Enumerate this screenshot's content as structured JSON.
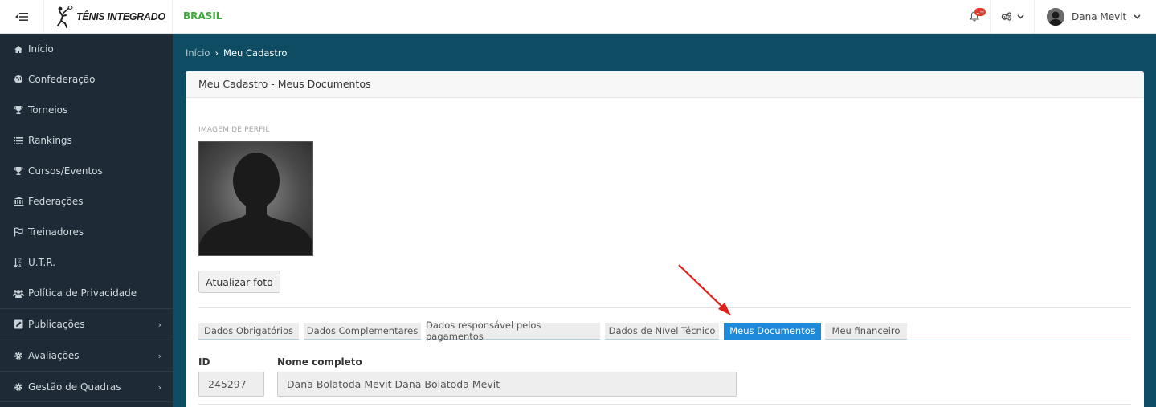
{
  "topbar": {
    "logo_text": "TÊNIS INTEGRADO",
    "country": "BRASIL",
    "notification_badge": "1+",
    "user_name": "Dana Mevit"
  },
  "sidebar": {
    "items": [
      {
        "label": "Início",
        "icon": "home-icon"
      },
      {
        "label": "Confederação",
        "icon": "globe-icon"
      },
      {
        "label": "Torneios",
        "icon": "trophy-icon"
      },
      {
        "label": "Rankings",
        "icon": "list-icon"
      },
      {
        "label": "Cursos/Eventos",
        "icon": "trophy-icon"
      },
      {
        "label": "Federações",
        "icon": "institution-icon"
      },
      {
        "label": "Treinadores",
        "icon": "flag-icon"
      },
      {
        "label": "U.T.R.",
        "icon": "sort-alpha-icon"
      },
      {
        "label": "Política de Privacidade",
        "icon": "users-icon"
      },
      {
        "label": "Publicações",
        "icon": "edit-icon",
        "arrow": "›"
      },
      {
        "label": "Avaliações",
        "icon": "gear-icon",
        "arrow": "›"
      },
      {
        "label": "Gestão de Quadras",
        "icon": "gear-icon",
        "arrow": "›"
      }
    ]
  },
  "breadcrumb": {
    "home": "Início",
    "separator": "›",
    "current": "Meu Cadastro"
  },
  "card": {
    "title": "Meu Cadastro - Meus Documentos",
    "profile_label": "IMAGEM DE PERFIL",
    "update_button": "Atualizar foto",
    "tabs": [
      {
        "label": "Dados Obrigatórios",
        "active": false
      },
      {
        "label": "Dados Complementares",
        "active": false
      },
      {
        "label": "Dados responsável pelos pagamentos",
        "active": false
      },
      {
        "label": "Dados de Nível Técnico",
        "active": false
      },
      {
        "label": "Meus Documentos",
        "active": true
      },
      {
        "label": "Meu financeiro",
        "active": false
      }
    ],
    "fields": {
      "id_label": "ID",
      "id_value": "245297",
      "name_label": "Nome completo",
      "name_value": "Dana Bolatoda Mevit Dana Bolatoda Mevit"
    }
  },
  "colors": {
    "page_bg": "#0e4c63",
    "sidebar_bg": "#1e2a35",
    "active_tab": "#1e88d9",
    "country": "#3aab3a",
    "arrow": "#e0211b"
  }
}
